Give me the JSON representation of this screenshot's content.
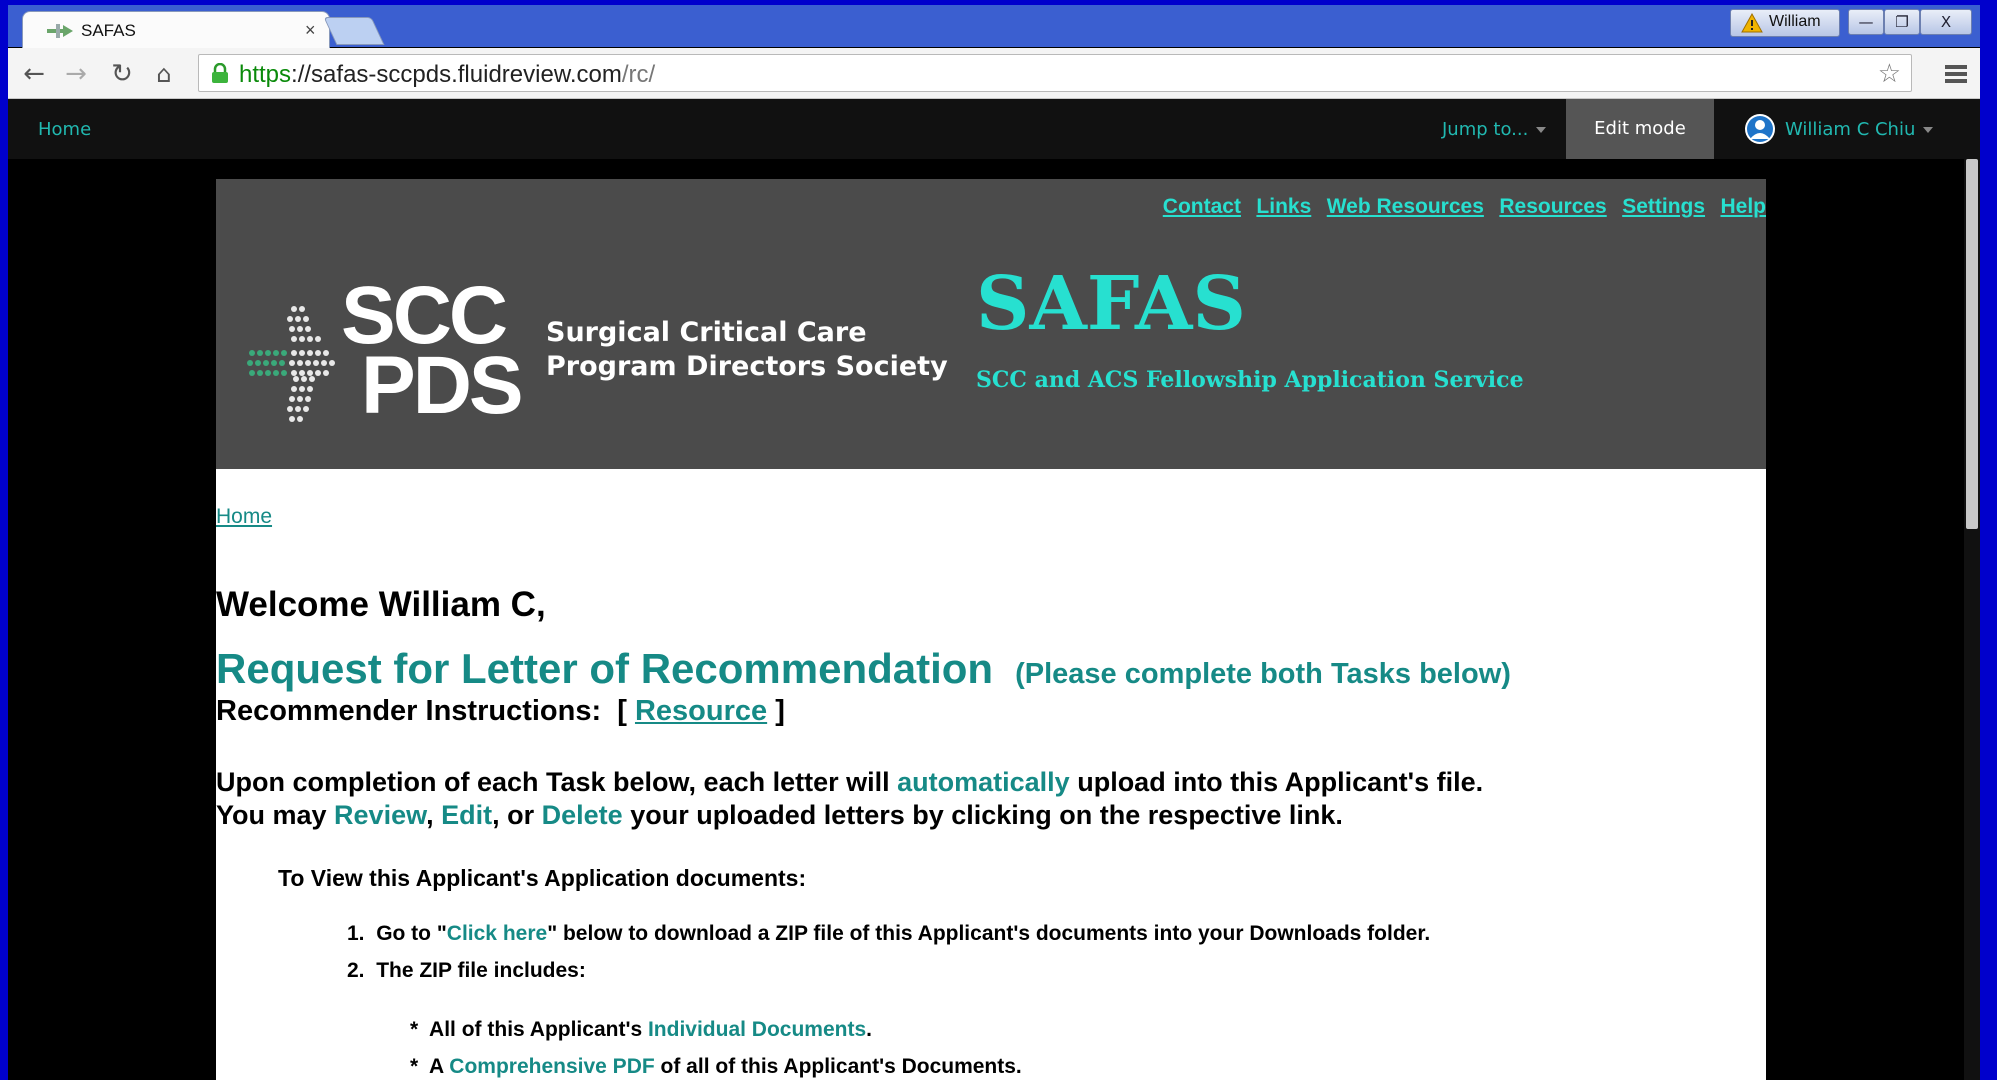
{
  "browser": {
    "tab": {
      "title": "SAFAS",
      "favicon": "arrow-cross-icon",
      "close": "×"
    },
    "profile_name": "William",
    "window_controls": {
      "minimize": "—",
      "restore": "❐",
      "close": "X"
    },
    "url": {
      "scheme": "https",
      "sep": "://",
      "host": "safas-sccpds.fluidreview.com",
      "path": "/rc/"
    },
    "icons": {
      "back": "back-arrow-icon",
      "forward": "forward-arrow-icon",
      "reload": "reload-icon",
      "home": "home-icon",
      "star": "star-icon",
      "menu": "menu-icon",
      "lock": "lock-icon"
    }
  },
  "appbar": {
    "home": "Home",
    "jump_to": "Jump to...",
    "edit_mode": "Edit mode",
    "user": "William C Chiu"
  },
  "banner": {
    "links": [
      "Contact",
      "Links",
      "Web Resources",
      "Resources",
      "Settings",
      "Help"
    ],
    "logo_scc": "SCC",
    "logo_pds": "PDS",
    "logo_line1": "Surgical Critical Care",
    "logo_line2": "Program Directors Society",
    "title": "SAFAS",
    "subtitle": "SCC and ACS Fellowship Application Service"
  },
  "main": {
    "breadcrumb": "Home",
    "welcome": "Welcome William C,",
    "request_title": "Request for Letter of Recommendation",
    "request_note": "(Please complete both Tasks below)",
    "instructions_prefix": "Recommender Instructions:  [ ",
    "instructions_link": "Resource",
    "instructions_suffix": " ]",
    "para1_a": "Upon completion of each Task below, each letter will ",
    "para1_link": "automatically",
    "para1_b": " upload into this Applicant's file.",
    "para2_a": "You may ",
    "para2_review": "Review",
    "para2_comma": ", ",
    "para2_edit": "Edit",
    "para2_or": ", or ",
    "para2_delete": "Delete",
    "para2_b": " your uploaded letters by clicking on the respective link.",
    "view_heading": "To View this Applicant's Application documents:",
    "step1_num": "1.",
    "step1_a": "Go to \"",
    "step1_link": "Click here",
    "step1_b": "\" below to download a ZIP file of this Applicant's documents into your Downloads folder.",
    "step2_num": "2.",
    "step2_text": "The ZIP file includes:",
    "bullet1_a": "*  All of this Applicant's ",
    "bullet1_link": "Individual Documents",
    "bullet1_b": ".",
    "bullet2_a": "*  A ",
    "bullet2_link": "Comprehensive PDF",
    "bullet2_b": " of all of this Applicant's Documents."
  },
  "colors": {
    "teal_link": "#168a86",
    "banner_teal": "#27e0d0",
    "banner_bg": "#4b4b4b",
    "appbar_bg": "#111111",
    "edit_mode_bg": "#555555"
  }
}
